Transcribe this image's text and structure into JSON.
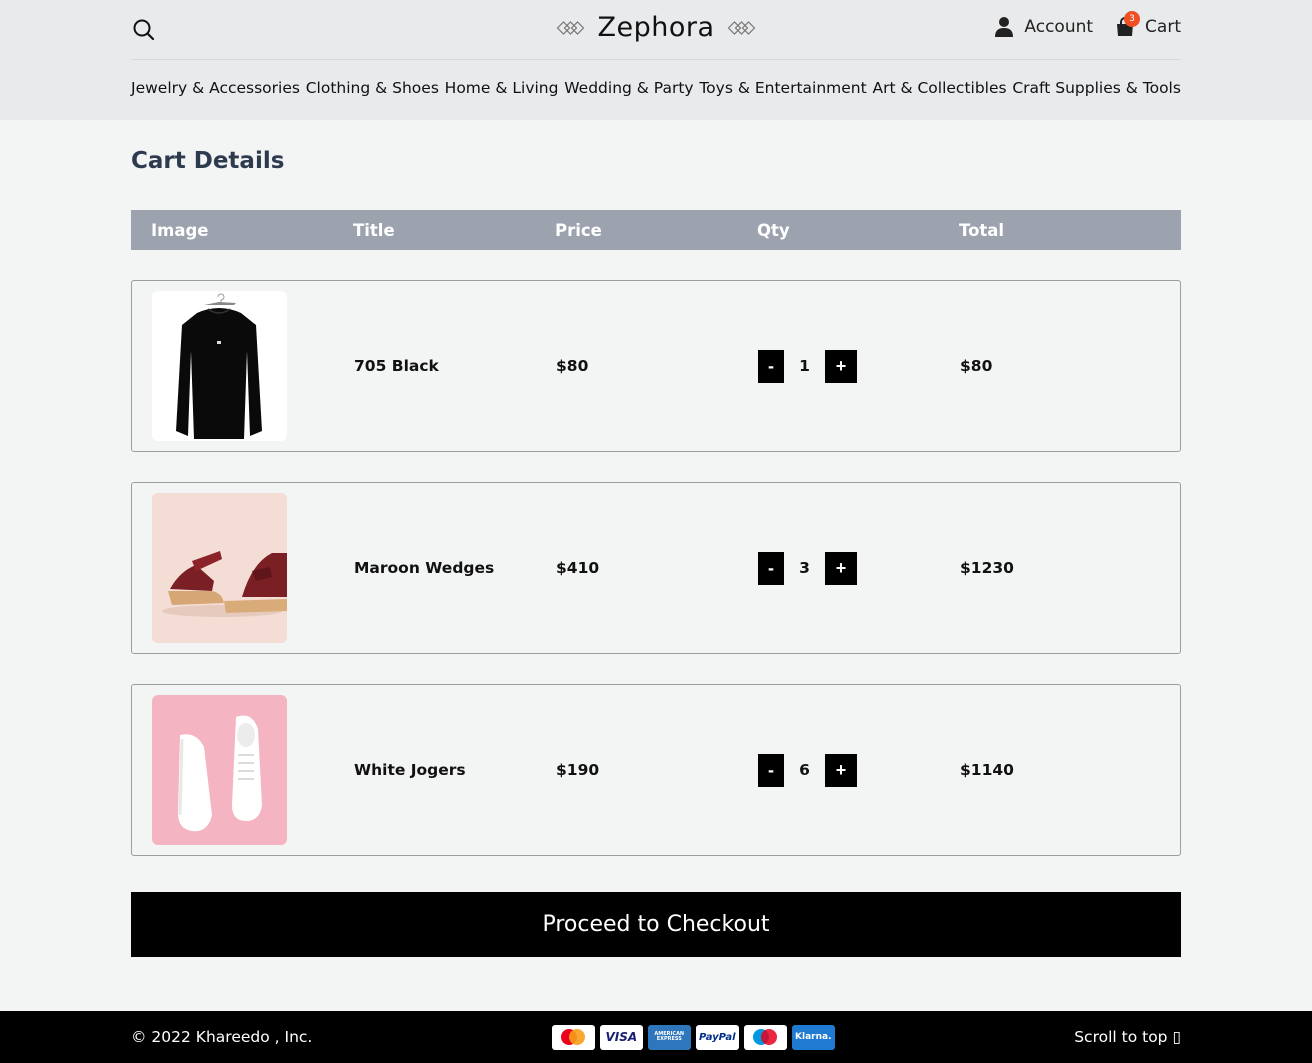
{
  "brand": {
    "name": "Zephora"
  },
  "header": {
    "account_label": "Account",
    "cart_label": "Cart",
    "cart_count": "3"
  },
  "nav": [
    "Jewelry & Accessories",
    "Clothing & Shoes",
    "Home & Living",
    "Wedding & Party",
    "Toys & Entertainment",
    "Art & Collectibles",
    "Craft Supplies & Tools"
  ],
  "page_title": "Cart Details",
  "table_headers": [
    "Image",
    "Title",
    "Price",
    "Qty",
    "Total"
  ],
  "items": [
    {
      "title": "705 Black",
      "price": "$80",
      "qty": "1",
      "total": "$80",
      "image": "black-sweatshirt-image"
    },
    {
      "title": "Maroon Wedges",
      "price": "$410",
      "qty": "3",
      "total": "$1230",
      "image": "maroon-wedges-image"
    },
    {
      "title": "White Jogers",
      "price": "$190",
      "qty": "6",
      "total": "$1140",
      "image": "white-sneakers-image"
    }
  ],
  "qty_controls": {
    "minus": "-",
    "plus": "+"
  },
  "checkout_label": "Proceed to Checkout",
  "footer": {
    "copyright": "© 2022 Khareedo , Inc.",
    "scroll_top": "Scroll to top ▯",
    "payments": [
      "mastercard-icon",
      "visa-icon",
      "american-express-icon",
      "paypal-icon",
      "maestro-icon",
      "klarna-icon"
    ],
    "payment_labels": {
      "visa": "VISA",
      "amex": "AMERICAN EXPRESS",
      "paypal": "PayPal",
      "klarna": "Klarna."
    }
  },
  "colors": {
    "header_bg": "#e9eaeb",
    "page_bg": "#f3f4f4",
    "table_header_bg": "#9ca3af",
    "title_color": "#2e3b4e",
    "badge": "#f04e23",
    "button": "#000000"
  }
}
